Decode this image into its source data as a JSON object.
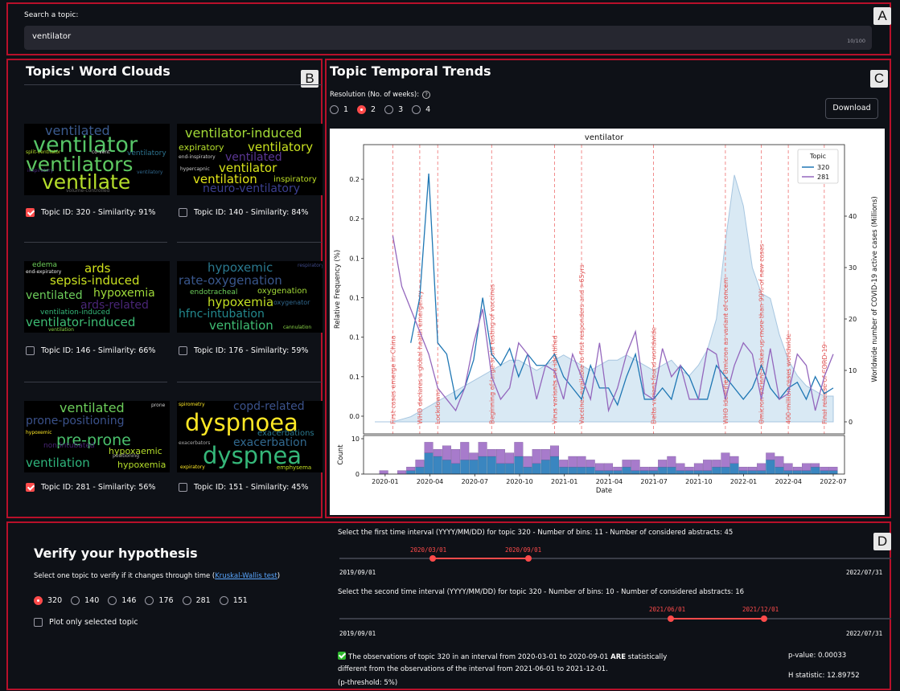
{
  "search": {
    "label": "Search a topic:",
    "value": "ventilator",
    "count": "10/100"
  },
  "panel_letters": {
    "a": "A",
    "b": "B",
    "c": "C",
    "d": "D"
  },
  "word_clouds": {
    "title": "Topics' Word Clouds",
    "items": [
      {
        "label": "Topic ID: 320 - Similarity: 91%",
        "checked": true,
        "words": [
          "ventilated",
          "ventilator",
          "ventilators",
          "ventilate",
          "split-ventilator",
          "co-vent",
          "ventilatory",
          "inspiratory",
          "ventilatory",
          "volume-controlled"
        ]
      },
      {
        "label": "Topic ID: 140 - Similarity: 84%",
        "checked": false,
        "words": [
          "ventilator-induced",
          "expiratory",
          "ventilatory",
          "end-inspiratory",
          "ventilated",
          "hypercapnic",
          "ventilator",
          "ventilation",
          "inspiratory",
          "neuro-ventilatory"
        ]
      },
      {
        "label": "Topic ID: 146 - Similarity: 66%",
        "checked": false,
        "words": [
          "edema",
          "end-expiratory",
          "ards",
          "sepsis-induced",
          "ventilated",
          "hypoxemia",
          "ards-related",
          "ventilation-induced",
          "ventilator-induced",
          "ventilation"
        ]
      },
      {
        "label": "Topic ID: 176 - Similarity: 59%",
        "checked": false,
        "words": [
          "hypoxemic",
          "respiratory",
          "rate-oxygenation",
          "endotracheal",
          "oxygenation",
          "hypoxemia",
          "oxygenator",
          "hfnc-intubation",
          "ventilation",
          "cannulation"
        ]
      },
      {
        "label": "Topic ID: 281 - Similarity: 56%",
        "checked": true,
        "words": [
          "ventilated",
          "prone",
          "prone-positioning",
          "hypoxemic",
          "pre-prone",
          "non-intubated",
          "hypoxaemic",
          "positioning",
          "ventilation",
          "hypoxemia"
        ]
      },
      {
        "label": "Topic ID: 151 - Similarity: 45%",
        "checked": false,
        "words": [
          "spirometry",
          "copd-related",
          "dyspnoea",
          "exacerbations",
          "exacerbators",
          "exacerbation",
          "dyspnea",
          "expiratory",
          "emphysema"
        ]
      }
    ]
  },
  "trends": {
    "title": "Topic Temporal Trends",
    "resolution_label": "Resolution (No. of weeks):",
    "help_glyph": "?",
    "options": [
      "1",
      "2",
      "3",
      "4"
    ],
    "selected": "2",
    "download_label": "Download"
  },
  "chart_data": {
    "type": "line",
    "title": "ventilator",
    "xlabel": "Date",
    "ylabel": "Relative Frequency (%)",
    "ylabel_right": "Worldwide number of COVID-19 active cases (Millions)",
    "ylabel_bottom": "Count",
    "x_ticks": [
      "2020-01",
      "2020-04",
      "2020-07",
      "2020-10",
      "2021-01",
      "2021-04",
      "2021-07",
      "2021-10",
      "2022-01",
      "2022-04",
      "2022-07"
    ],
    "y_ticks_left_printed": [
      "0.0",
      "0.1",
      "0.1",
      "0.1",
      "0.1",
      "0.2",
      "0.2"
    ],
    "y_ticks_right": [
      0,
      10,
      20,
      30,
      40
    ],
    "y_ticks_bottom": [
      0,
      10
    ],
    "legend_title": "Topic",
    "legend_placement": "top-right",
    "series": [
      {
        "name": "320",
        "color": "#1f77b4",
        "values": [
          null,
          null,
          null,
          null,
          0.07,
          0.11,
          0.22,
          0.07,
          0.06,
          0.02,
          0.03,
          0.055,
          0.11,
          0.06,
          0.05,
          0.065,
          0.04,
          0.06,
          0.05,
          0.05,
          0.06,
          0.04,
          0.03,
          0.02,
          0.05,
          0.03,
          0.03,
          0.015,
          0.04,
          0.06,
          0.02,
          0.02,
          0.03,
          0.02,
          0.05,
          0.04,
          0.02,
          0.02,
          0.05,
          0.04,
          0.03,
          0.02,
          0.03,
          0.05,
          0.03,
          0.02,
          0.03,
          0.035,
          0.02,
          0.04,
          0.025,
          0.03
        ]
      },
      {
        "name": "281",
        "color": "#9467bd",
        "values": [
          null,
          null,
          0.165,
          0.12,
          0.1,
          0.08,
          0.06,
          0.03,
          0.02,
          0.01,
          0.03,
          0.07,
          0.1,
          0.04,
          0.02,
          0.03,
          0.07,
          0.06,
          0.02,
          0.05,
          0.045,
          0.02,
          0.06,
          0.04,
          0.02,
          0.07,
          0.01,
          0.03,
          0.06,
          0.08,
          0.025,
          0.02,
          0.065,
          0.04,
          0.05,
          0.02,
          0.02,
          0.065,
          0.06,
          0.02,
          0.05,
          0.07,
          0.06,
          0.02,
          0.065,
          0.02,
          0.025,
          0.06,
          0.05,
          0.01,
          0.04,
          0.06
        ]
      }
    ],
    "cases_millions": [
      0,
      0,
      0,
      0.5,
      1,
      2,
      3,
      4,
      5,
      6,
      7,
      8,
      9,
      10,
      11,
      12,
      12,
      11,
      10,
      11,
      12,
      13,
      12,
      11,
      10,
      11,
      12,
      12,
      13,
      12,
      11,
      10,
      11,
      12,
      10,
      9,
      11,
      14,
      20,
      35,
      48,
      42,
      30,
      25,
      24,
      17,
      12,
      9,
      7,
      6,
      5,
      5
    ],
    "events": [
      "First cases emerge in China",
      "WHO declares a global health emergency",
      "Lockdowns",
      "Beginning of large-scale testing of vaccines",
      "Virus variants are identified",
      "Vaccines available to first responders and >65yrs",
      "Delta variant found worldwide",
      "WHO identifies Omicron as variant of concern",
      "Omicron variant makes up more than 99% of new cases",
      "400 million cases worldwide",
      "Final release of CORD-19"
    ],
    "counts_320": [
      0,
      0,
      0,
      0,
      1,
      2,
      6,
      5,
      4,
      3,
      4,
      4,
      5,
      5,
      3,
      3,
      5,
      2,
      3,
      4,
      5,
      2,
      2,
      2,
      2,
      1,
      1,
      1,
      2,
      1,
      1,
      1,
      2,
      2,
      1,
      1,
      1,
      1,
      2,
      2,
      3,
      1,
      1,
      1,
      4,
      2,
      1,
      1,
      1,
      2,
      1,
      1
    ],
    "counts_281": [
      0,
      1,
      0,
      1,
      1,
      2,
      3,
      2,
      4,
      4,
      5,
      2,
      4,
      2,
      4,
      3,
      4,
      3,
      4,
      3,
      3,
      2,
      3,
      3,
      2,
      2,
      2,
      1,
      2,
      3,
      1,
      1,
      2,
      3,
      2,
      1,
      2,
      3,
      2,
      4,
      2,
      1,
      1,
      2,
      2,
      3,
      2,
      1,
      2,
      1,
      1,
      1
    ]
  },
  "verify": {
    "title": "Verify your hypothesis",
    "prompt": "Select one topic to verify if it changes through time (",
    "link": "Kruskal-Wallis test",
    "prompt_end": ")",
    "options": [
      "320",
      "140",
      "146",
      "176",
      "281",
      "151"
    ],
    "selected": "320",
    "plot_only_label": "Plot only selected topic",
    "interval1_label": "Select the first time interval (YYYY/MM/DD) for topic 320 - Number of bins: 11 - Number of considered abstracts: 45",
    "interval1_start": "2020/03/01",
    "interval1_end": "2020/09/01",
    "interval2_label": "Select the second time interval (YYYY/MM/DD) for topic 320 - Number of bins: 10 - Number of considered abstracts: 16",
    "interval2_start": "2021/06/01",
    "interval2_end": "2021/12/01",
    "range_min": "2019/09/01",
    "range_max": "2022/07/31",
    "result_line1_a": "The observations of topic 320 in an interval from 2020-03-01 to 2020-09-01 ",
    "result_bold": "ARE",
    "result_line1_b": " statistically",
    "result_line2": "different from the observations of the interval from 2021-06-01 to 2021-12-01.",
    "result_line3": "(p-threshold: 5%)",
    "p_value": "p-value: 0.00033",
    "h_stat": "H statistic: 12.89752"
  }
}
